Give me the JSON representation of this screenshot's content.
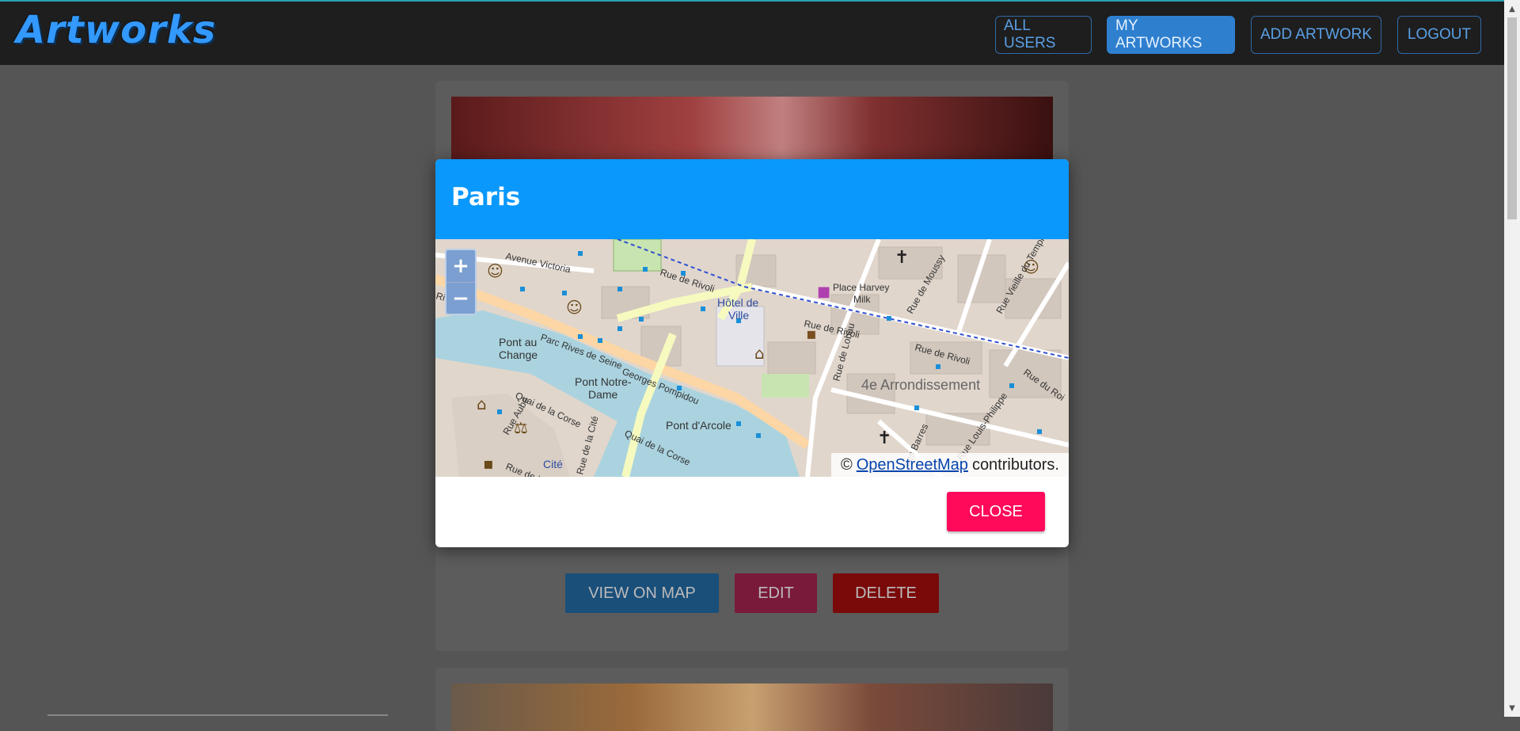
{
  "navbar": {
    "brand": "Artworks",
    "buttons": [
      {
        "label": "ALL USERS",
        "active": false
      },
      {
        "label": "MY ARTWORKS",
        "active": true
      },
      {
        "label": "ADD ARTWORK",
        "active": false
      },
      {
        "label": "LOGOUT",
        "active": false
      }
    ]
  },
  "card": {
    "buttons": {
      "view_map": "VIEW ON MAP",
      "edit": "EDIT",
      "delete": "DELETE"
    }
  },
  "modal": {
    "title": "Paris",
    "close_label": "CLOSE",
    "map": {
      "zoom_in": "+",
      "zoom_out": "−",
      "attribution_prefix": "©",
      "attribution_link": "OpenStreetMap",
      "attribution_suffix": "contributors.",
      "labels": {
        "avenue_victoria": "Avenue Victoria",
        "rue_rivoli_1": "Rue de Rivoli",
        "hotel_de_ville_1": "Hôtel de",
        "hotel_de_ville_2": "Ville",
        "place_harvey_1": "Place Harvey",
        "place_harvey_2": "Milk",
        "rue_mousy": "Rue de Moussy",
        "rue_vieille_temple": "Rue Vieille du Temple",
        "pont_change_1": "Pont au",
        "pont_change_2": "Change",
        "parc_rives": "Parc Rives de Seine",
        "georges_pompidou": "Georges Pompidou",
        "rue_rivoli_2": "Rue de Rivoli",
        "rue_rivoli_3": "Rue de Rivoli",
        "rue_lobau": "Rue de Lobau",
        "rue_du_roi": "Rue du Roi",
        "arrondissement": "4e Arrondissement",
        "pont_notre_dame_1": "Pont Notre-",
        "pont_notre_dame_2": "Dame",
        "quai_corse_1": "Quai de la Corse",
        "rue_aube": "Rue Aubé",
        "pont_arcole": "Pont d'Arcole",
        "quai_corse_2": "Quai de la Corse",
        "rue_cite": "Rue de la Cité",
        "cite": "Cité",
        "rue_de_lu": "Rue de Lu",
        "rue_louis_philippe": "Rue Louis-Philippe",
        "rue_barres": "des Barres",
        "rives": "Rives"
      }
    }
  },
  "colors": {
    "navbar_bg": "#1e1e1e",
    "accent_blue": "#0a98fc",
    "close_red": "#ff0a5a",
    "brand_blue": "#3399ff"
  }
}
